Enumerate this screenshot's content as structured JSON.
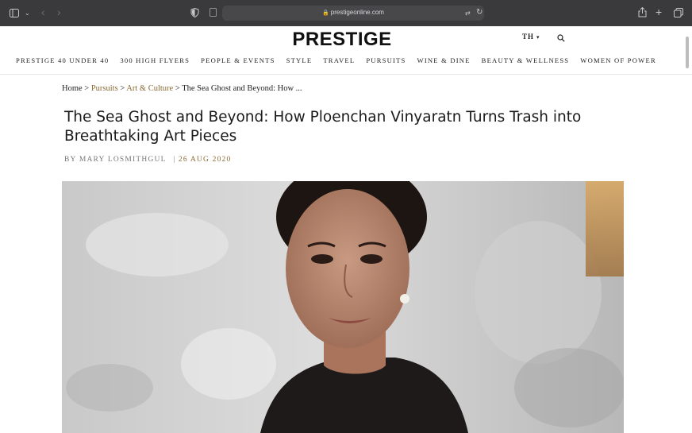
{
  "browser": {
    "url": "prestigeonline.com"
  },
  "site": {
    "brand": "PRESTIGE",
    "language": "TH",
    "nav": [
      "PRESTIGE 40 UNDER 40",
      "300 HIGH FLYERS",
      "PEOPLE & EVENTS",
      "STYLE",
      "TRAVEL",
      "PURSUITS",
      "WINE & DINE",
      "BEAUTY & WELLNESS",
      "WOMEN OF POWER"
    ]
  },
  "breadcrumb": {
    "home": "Home",
    "sep": " > ",
    "pursuits": "Pursuits",
    "art": "Art & Culture",
    "current": "The Sea Ghost and Beyond: How ..."
  },
  "article": {
    "title": "The Sea Ghost and Beyond: How Ploenchan Vinyaratn Turns Trash into Breathtaking Art Pieces",
    "author": "BY MARY LOSMITHGUL",
    "date_sep": "|",
    "date": "26 AUG 2020"
  },
  "icons": {
    "sidebar": "sidebar-icon",
    "back": "chevron-left-icon",
    "forward": "chevron-right-icon",
    "privacy": "shield-icon",
    "lock": "lock-icon",
    "translate": "translate-icon",
    "reload": "reload-icon",
    "share": "share-icon",
    "new_tab": "plus-icon",
    "tabs": "tabs-overview-icon",
    "search": "search-icon"
  }
}
